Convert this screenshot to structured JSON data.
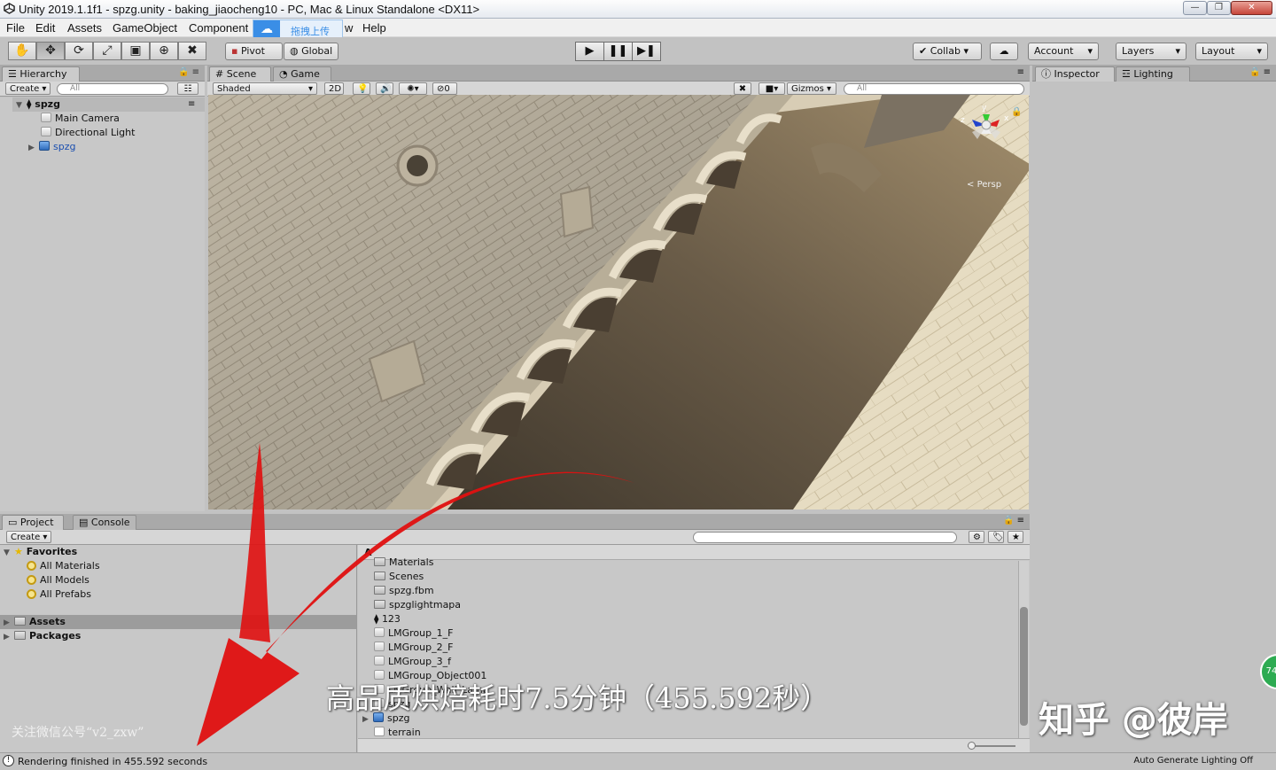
{
  "window": {
    "title": "Unity 2019.1.1f1 - spzg.unity - baking_jiaocheng10 - PC, Mac & Linux Standalone <DX11>",
    "minimize": "—",
    "maximize": "❐",
    "close": "✕"
  },
  "menu": {
    "items": [
      "File",
      "Edit",
      "Assets",
      "GameObject",
      "Component",
      "w",
      "Help"
    ]
  },
  "baidu_overlay": {
    "label": "拖拽上传"
  },
  "toolbar": {
    "tools": [
      "hand-tool",
      "move-tool",
      "rotate-tool",
      "scale-tool",
      "rect-tool",
      "transform-tool",
      "custom-tool"
    ],
    "pivot": "Pivot",
    "global": "Global",
    "collab": "Collab",
    "account": "Account",
    "layers": "Layers",
    "layout": "Layout"
  },
  "hierarchy": {
    "tab": "Hierarchy",
    "create": "Create",
    "search_placeholder": "All",
    "scene_name": "spzg",
    "items": [
      "Main Camera",
      "Directional Light",
      "spzg"
    ]
  },
  "scene": {
    "tabs": [
      "Scene",
      "Game"
    ],
    "shading": "Shaded",
    "mode_2d": "2D",
    "hidden_count": "0",
    "gizmos": "Gizmos",
    "search_placeholder": "All",
    "persp_label": "Persp",
    "axes": {
      "x": "x",
      "y": "y",
      "z": "z"
    }
  },
  "inspector": {
    "tabs": [
      "Inspector",
      "Lighting"
    ]
  },
  "project": {
    "tabs": [
      "Project",
      "Console"
    ],
    "create": "Create",
    "favorites": {
      "label": "Favorites",
      "items": [
        "All Materials",
        "All Models",
        "All Prefabs"
      ]
    },
    "roots": [
      "Assets",
      "Packages"
    ],
    "breadcrumb": "A",
    "assets": [
      "Materials",
      "Scenes",
      "spzg.fbm",
      "spzglightmapa",
      "123",
      "LMGroup_1_F",
      "LMGroup_2_F",
      "LMGroup_3_f",
      "LMGroup_Object001",
      "LMGroup_Wall_Lamp",
      "spzg",
      "spzg",
      "terrain"
    ]
  },
  "status": {
    "message": "Rendering finished in 455.592 seconds",
    "lighting": "Auto Generate Lighting Off"
  },
  "overlays": {
    "caption": "高品质烘焙耗时7.5分钟（455.592秒）",
    "watermark": "知乎 @彼岸",
    "wechat": "关注微信公号“v2_zxw”",
    "badge": "74"
  }
}
